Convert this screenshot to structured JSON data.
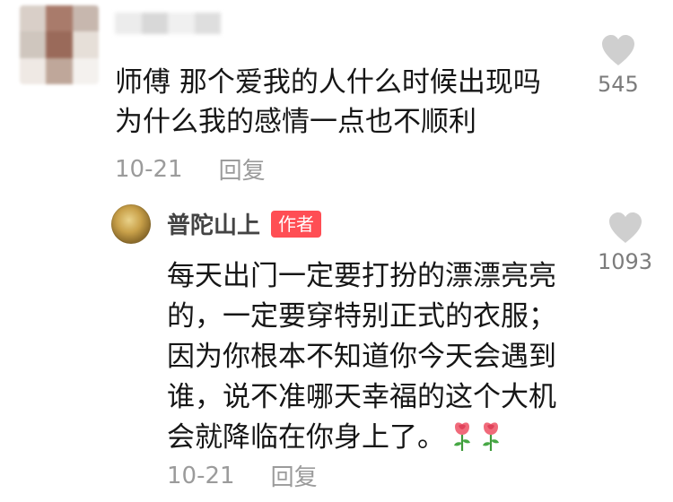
{
  "comment": {
    "username_blurred": "",
    "text": "师傅 那个爱我的人什么时候出现吗\n为什么我的感情一点也不顺利",
    "date": "10-21",
    "reply_label": "回复",
    "likes": "545",
    "avatar_colors": [
      "#d9cfc8",
      "#a97b6b",
      "#c7b7ae",
      "#cfc6be",
      "#9a6a5a",
      "#e6dfd8",
      "#efe9e4",
      "#bfa79a",
      "#f4f1ee"
    ]
  },
  "reply": {
    "author": "普陀山上",
    "badge": "作者",
    "text": "每天出门一定要打扮的漂漂亮亮\n的，一定要穿特别正式的衣服；\n因为你根本不知道你今天会遇到\n谁，说不准哪天幸福的这个大机\n会就降临在你身上了。",
    "emoji": [
      "rose-icon",
      "rose-icon"
    ],
    "date": "10-21",
    "reply_label": "回复",
    "likes": "1093"
  },
  "colors": {
    "text": "#161616",
    "meta": "#9b9b9b",
    "heart": "#cfcfcf",
    "badge": "#ff4e54"
  }
}
